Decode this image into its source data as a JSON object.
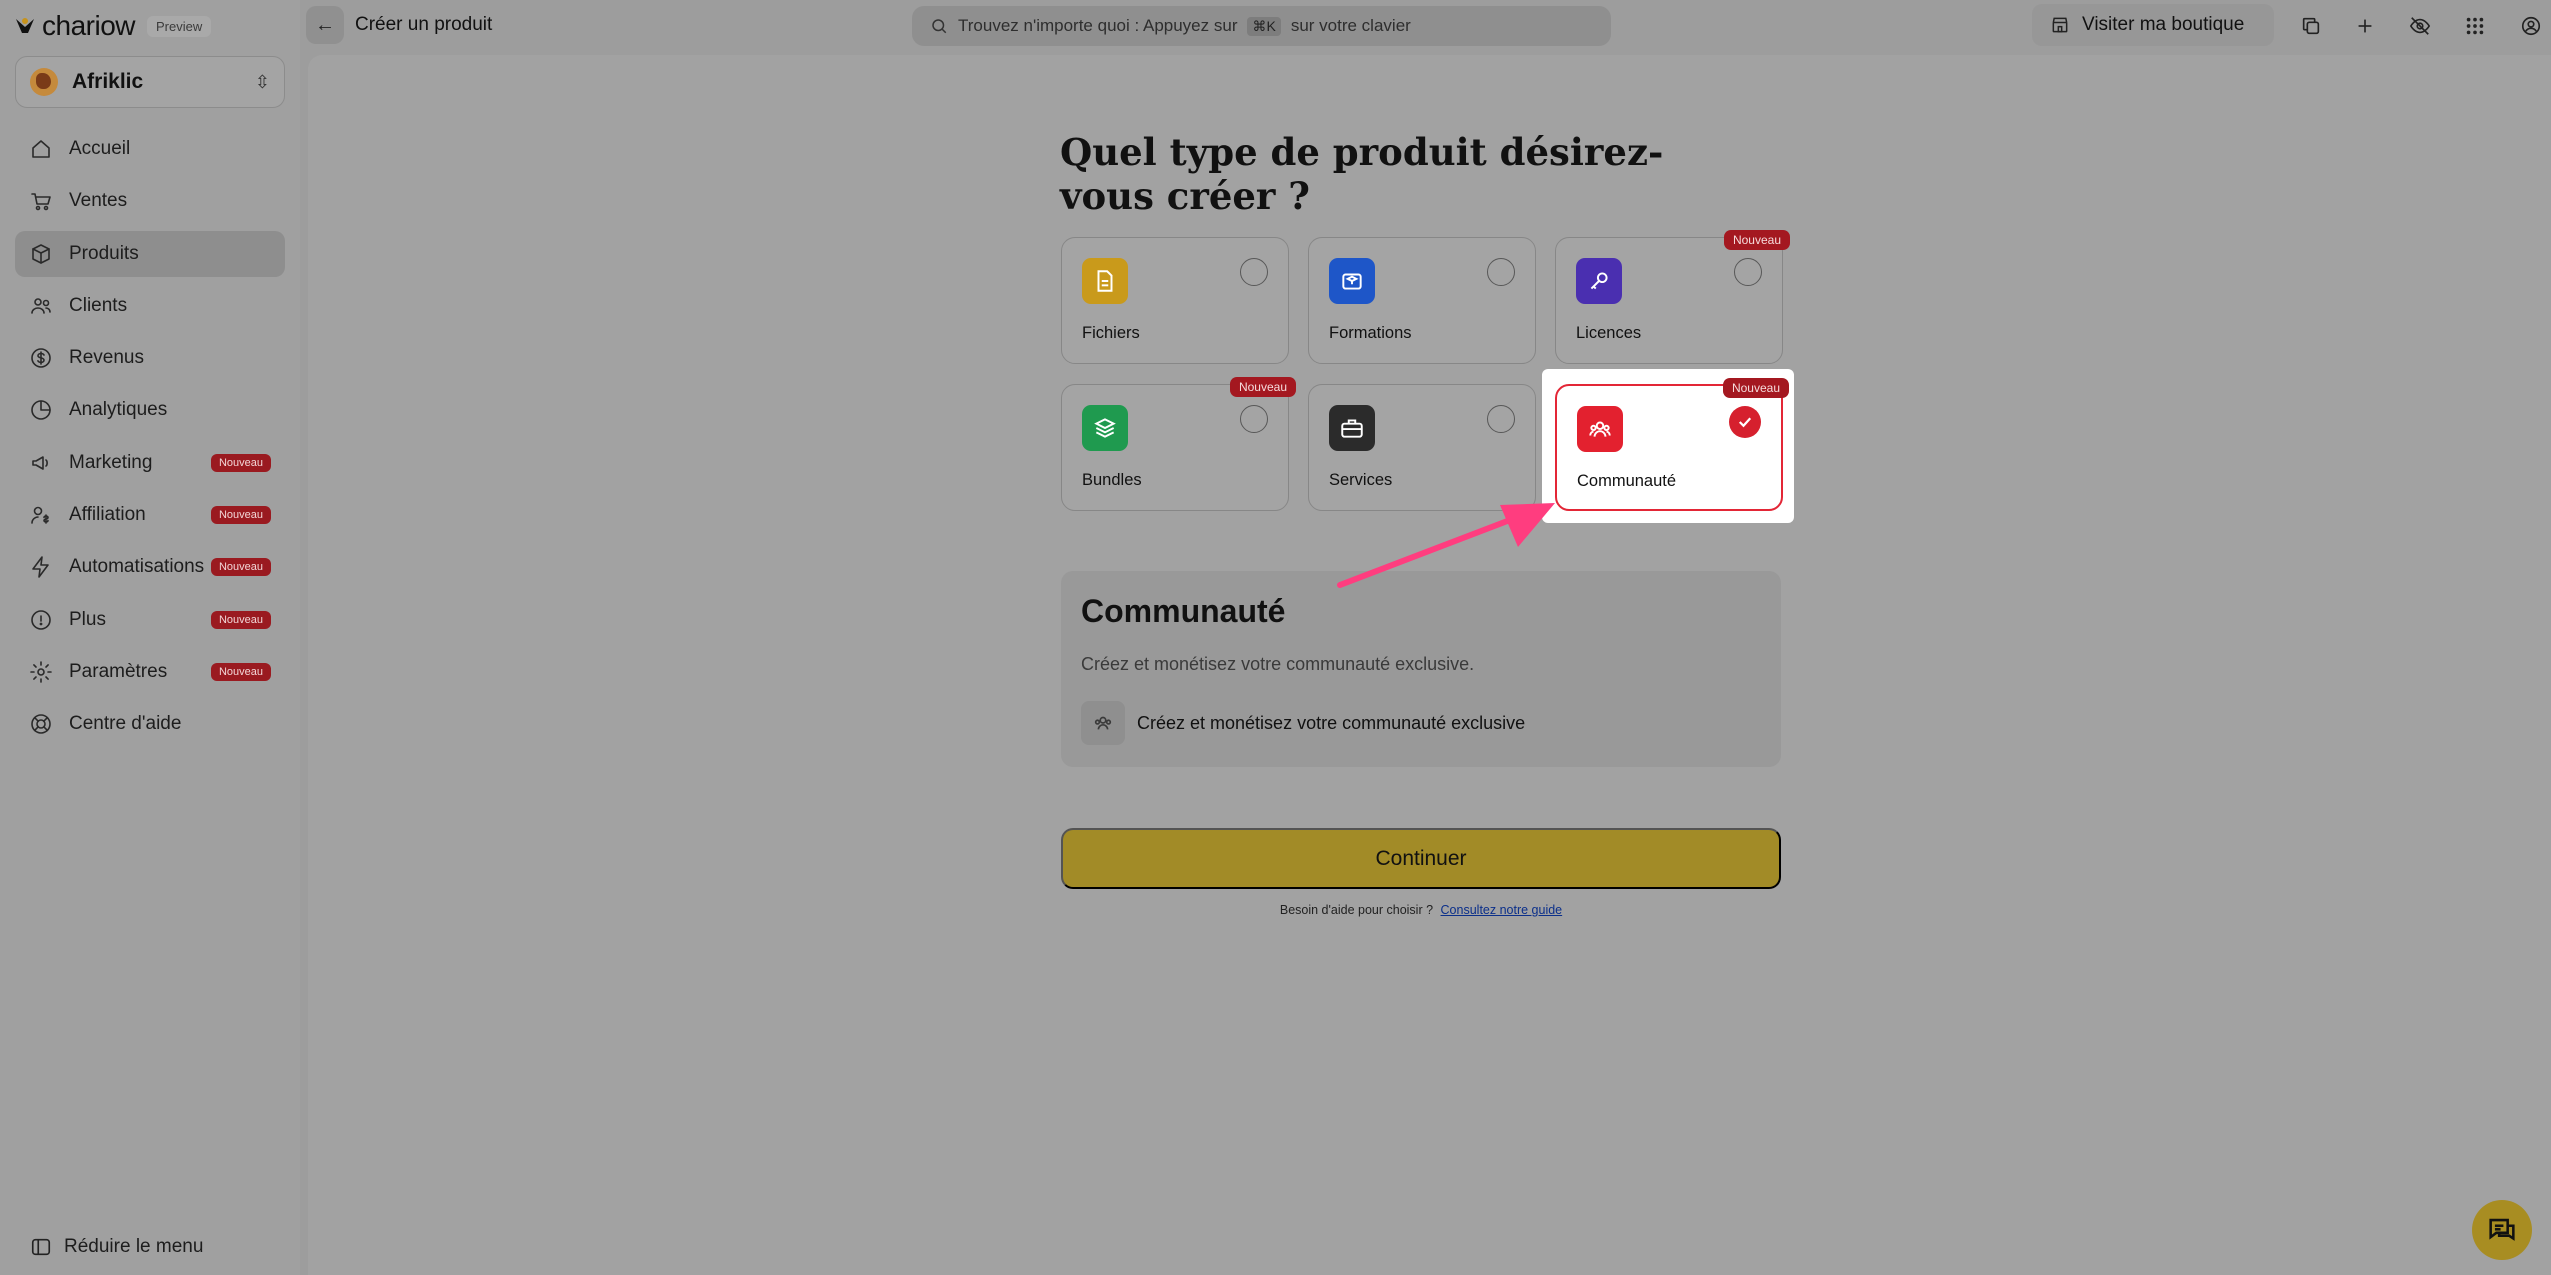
{
  "brand": {
    "name": "chariow",
    "preview": "Preview"
  },
  "workspace": {
    "name": "Afriklic"
  },
  "sidebar": {
    "items": [
      {
        "label": "Accueil",
        "icon": "home-icon",
        "badge": ""
      },
      {
        "label": "Ventes",
        "icon": "cart-icon",
        "badge": ""
      },
      {
        "label": "Produits",
        "icon": "box-icon",
        "badge": "",
        "active": true
      },
      {
        "label": "Clients",
        "icon": "users-icon",
        "badge": ""
      },
      {
        "label": "Revenus",
        "icon": "money-icon",
        "badge": ""
      },
      {
        "label": "Analytiques",
        "icon": "chart-icon",
        "badge": ""
      },
      {
        "label": "Marketing",
        "icon": "megaphone-icon",
        "badge": "Nouveau"
      },
      {
        "label": "Affiliation",
        "icon": "affiliate-icon",
        "badge": "Nouveau"
      },
      {
        "label": "Automatisations",
        "icon": "bolt-icon",
        "badge": "Nouveau"
      },
      {
        "label": "Plus",
        "icon": "more-icon",
        "badge": "Nouveau"
      },
      {
        "label": "Paramètres",
        "icon": "gear-icon",
        "badge": "Nouveau"
      },
      {
        "label": "Centre d'aide",
        "icon": "help-icon",
        "badge": ""
      }
    ],
    "collapse_label": "Réduire le menu"
  },
  "topbar": {
    "title": "Créer un produit",
    "search_text": "Trouvez n'importe quoi : Appuyez sur",
    "search_kbd": "⌘K",
    "search_suffix": "sur votre clavier",
    "visit_label": "Visiter ma boutique"
  },
  "main": {
    "question": "Quel type de produit désirez-vous créer ?",
    "new_badge": "Nouveau",
    "types": [
      {
        "label": "Fichiers",
        "icon": "file-icon",
        "color": "#c99a1b"
      },
      {
        "label": "Formations",
        "icon": "graduation-icon",
        "color": "#1e56c8"
      },
      {
        "label": "Licences",
        "icon": "key-icon",
        "color": "#4a2fb0"
      },
      {
        "label": "Bundles",
        "icon": "layers-icon",
        "color": "#1f9a4f"
      },
      {
        "label": "Services",
        "icon": "briefcase-icon",
        "color": "#2b2b2b"
      },
      {
        "label": "Communauté",
        "icon": "community-icon",
        "color": "#e3212f"
      }
    ],
    "selected": "Communauté",
    "description": {
      "title": "Communauté",
      "subtitle": "Créez et monétisez votre communauté exclusive.",
      "feature": "Créez et monétisez votre communauté exclusive"
    },
    "continue_label": "Continuer",
    "help_text": "Besoin d'aide pour choisir ?",
    "help_link": "Consultez notre guide"
  },
  "colors": {
    "accent": "#a28b27",
    "danger": "#e32636",
    "arrow": "#ff3d7f"
  }
}
